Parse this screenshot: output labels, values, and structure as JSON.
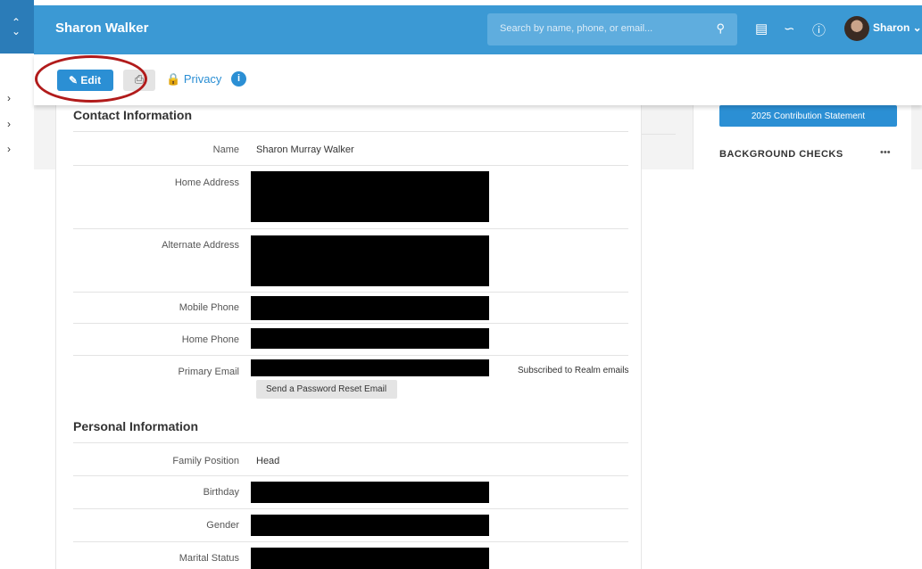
{
  "header": {
    "title": "Sharon Walker",
    "search_placeholder": "Search by name, phone, or email...",
    "user_name": "Sharon",
    "brand_color": "#3b99d4",
    "icons": [
      "search-icon",
      "chat-icon",
      "realm-icon",
      "help-icon",
      "avatar"
    ]
  },
  "toolbar": {
    "edit_label": "Edit",
    "privacy_label": "Privacy",
    "icons": [
      "pencil-icon",
      "print-icon",
      "lock-icon",
      "info-icon"
    ],
    "highlight_color": "#b11b1b"
  },
  "contact": {
    "title": "Contact Information",
    "name_label": "Name",
    "name_value": "Sharon Murray Walker",
    "home_address_label": "Home Address",
    "alternate_address_label": "Alternate Address",
    "mobile_phone_label": "Mobile Phone",
    "home_phone_label": "Home Phone",
    "primary_email_label": "Primary Email",
    "subscription": "Subscribed to Realm emails",
    "reset_button": "Send a Password Reset Email"
  },
  "personal": {
    "title": "Personal Information",
    "family_position_label": "Family Position",
    "family_position_value": "Head",
    "birthday_label": "Birthday",
    "gender_label": "Gender",
    "marital_status_label": "Marital Status"
  },
  "sidebar": {
    "contribution_button": "2025 Contribution Statement",
    "background_checks_title": "BACKGROUND CHECKS"
  }
}
